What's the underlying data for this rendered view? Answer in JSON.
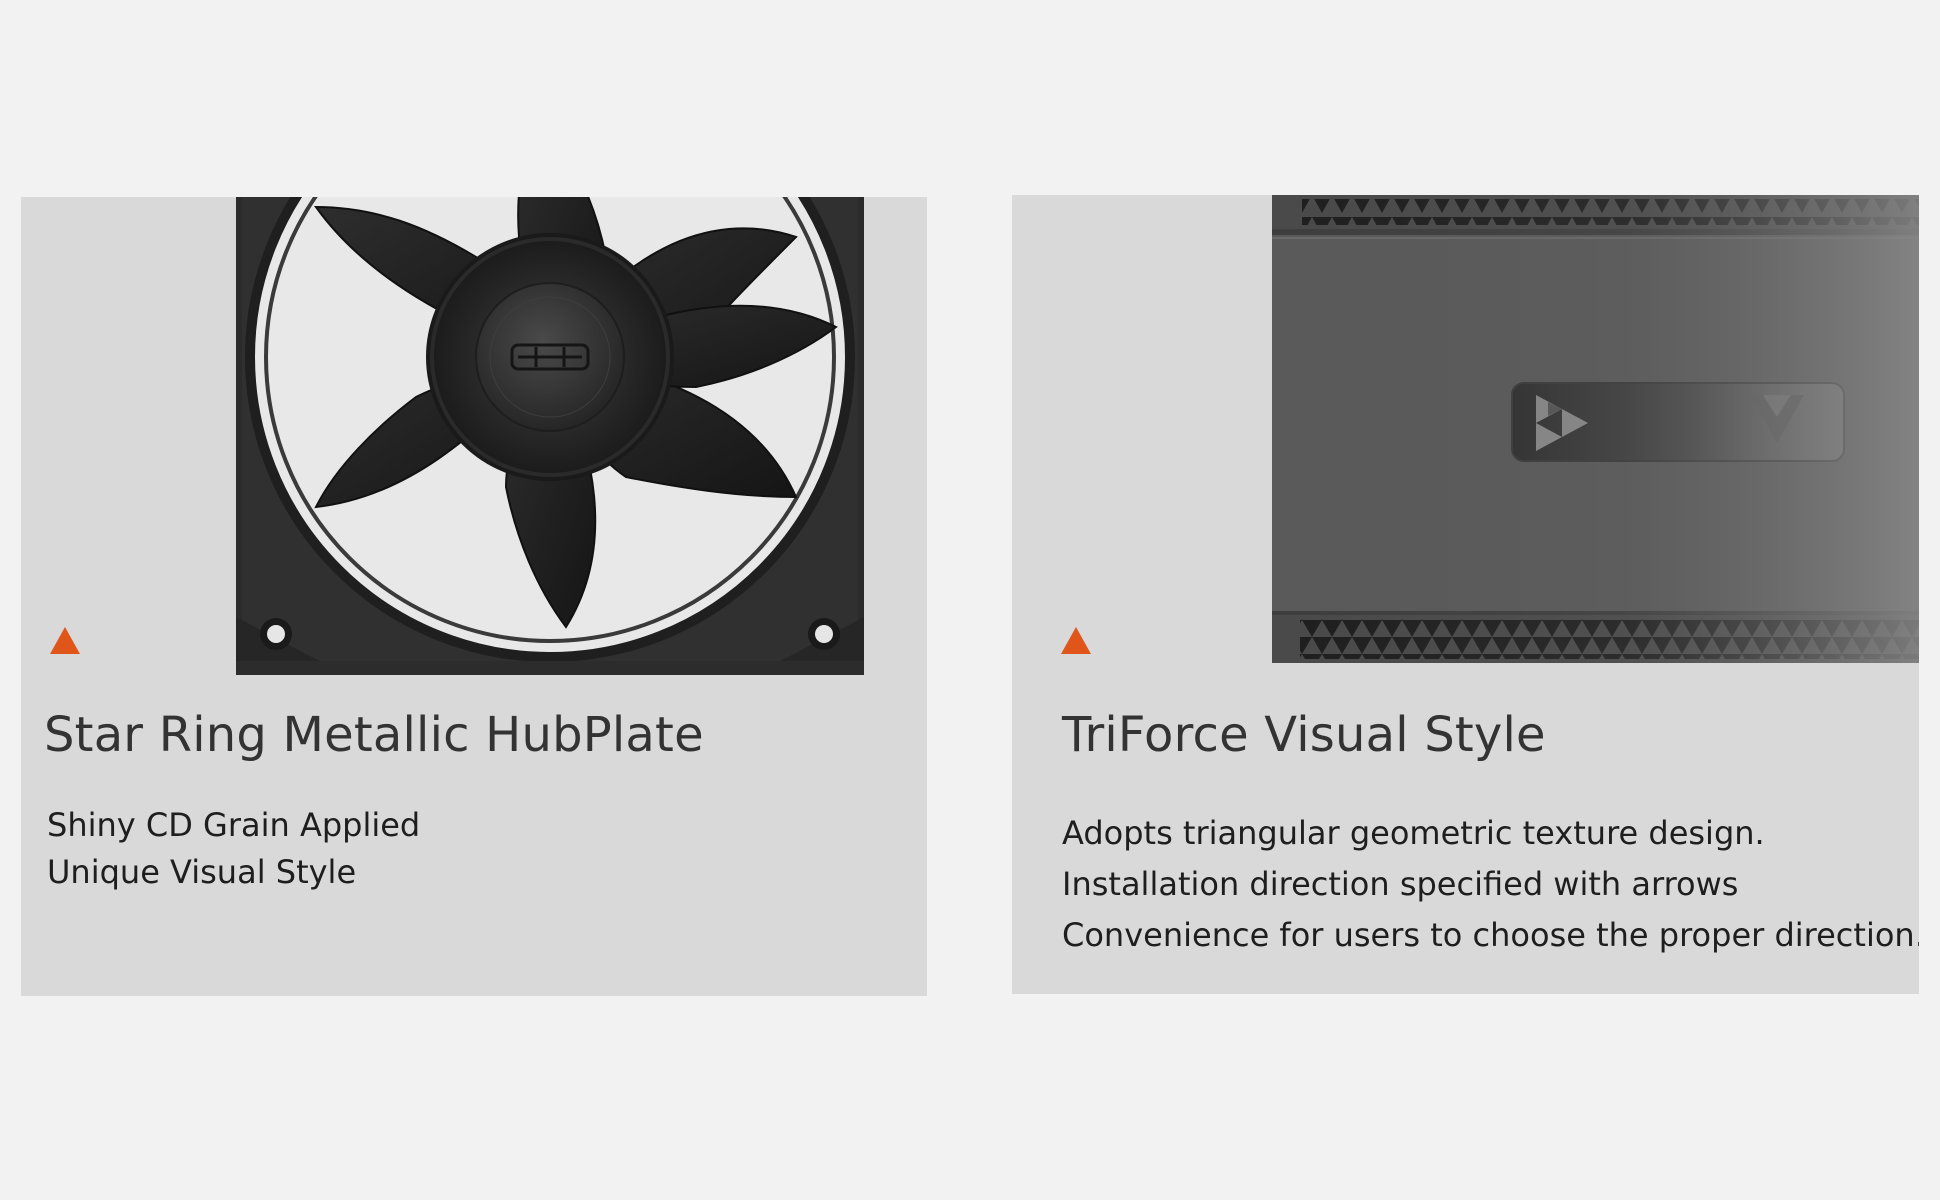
{
  "cards": [
    {
      "title": "Star Ring Metallic HubPlate",
      "lines": [
        "Shiny CD Grain Applied",
        "Unique Visual Style"
      ],
      "image": "fan-hubplate-closeup"
    },
    {
      "title": "TriForce Visual Style",
      "lines": [
        "Adopts triangular geometric texture design.",
        "Installation direction specified with arrows",
        "Convenience for users to choose the proper direction."
      ],
      "image": "fan-frame-triangle-texture"
    }
  ],
  "colors": {
    "page_background": "#f2f2f2",
    "card_background": "#d9d9d9",
    "accent": "#e0561a",
    "title_text": "#333333",
    "body_text": "#1e1e1e"
  },
  "icons": {
    "accent_marker": "triangle-icon"
  }
}
